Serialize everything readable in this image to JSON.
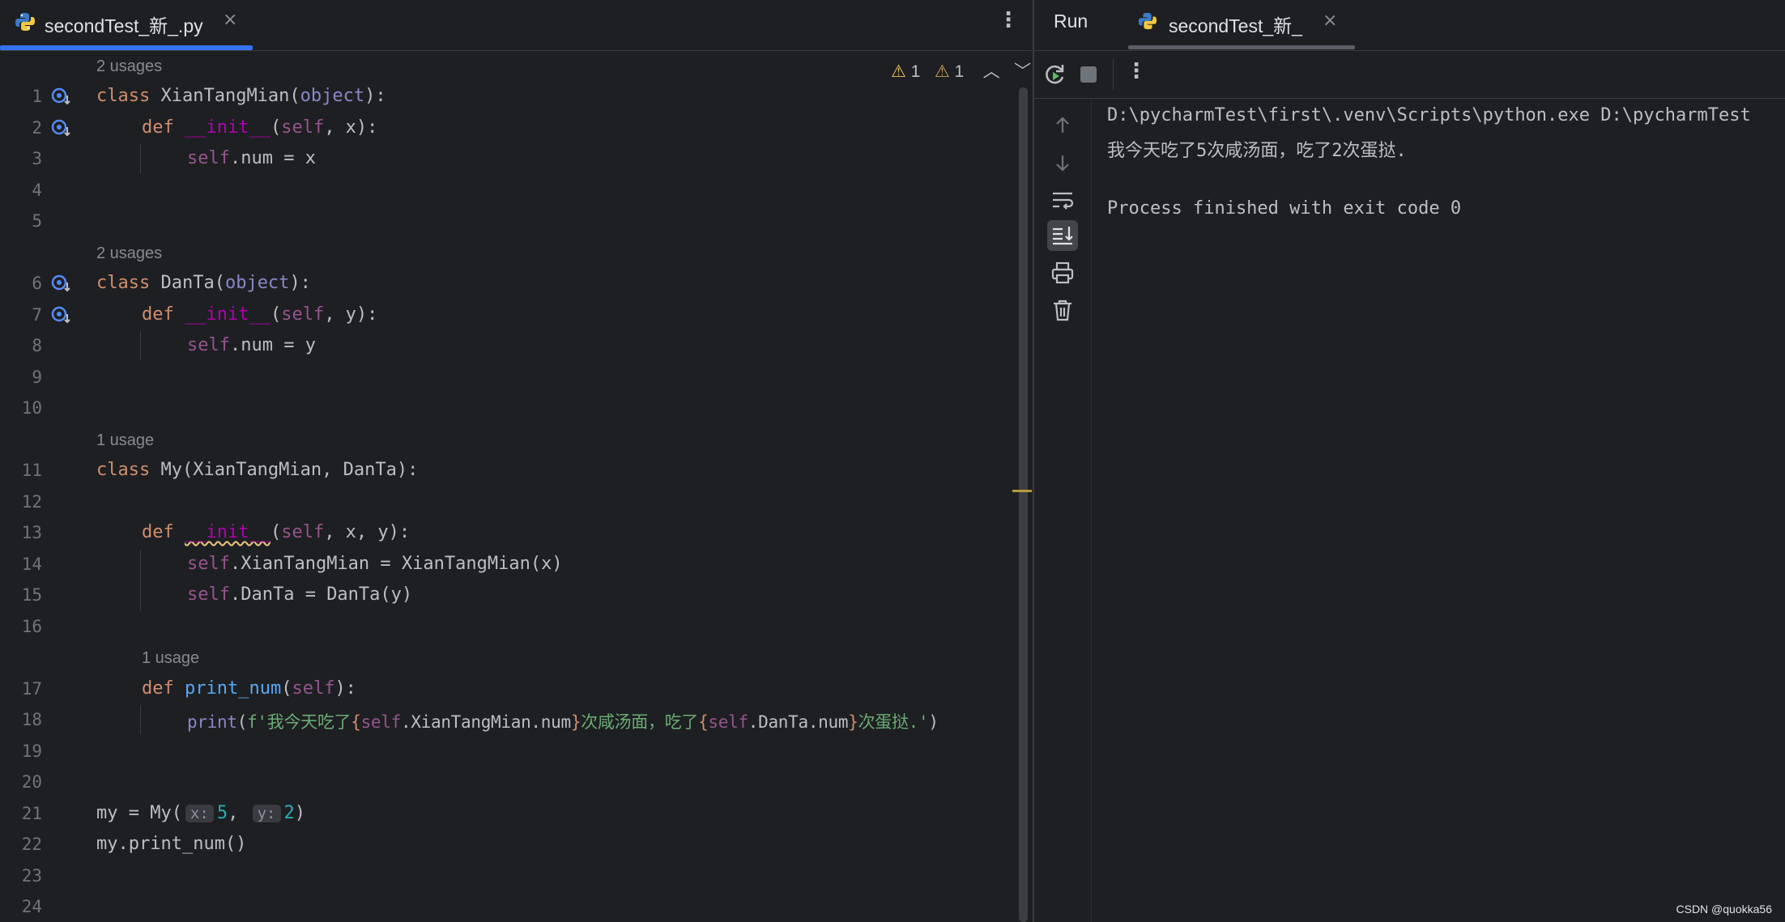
{
  "editor": {
    "tab_name": "secondTest_新_.py",
    "close_glyph": "×",
    "menu_glyph": "⋮",
    "inspections": {
      "warnings": "1",
      "weak_warnings": "1"
    },
    "usages": [
      "2 usages",
      "2 usages",
      "1 usage",
      "1 usage"
    ],
    "line_numbers": [
      "1",
      "2",
      "3",
      "4",
      "5",
      "6",
      "7",
      "8",
      "9",
      "10",
      "11",
      "12",
      "13",
      "14",
      "15",
      "16",
      "17",
      "18",
      "19",
      "20",
      "21",
      "22",
      "23",
      "24"
    ],
    "code": {
      "l1": {
        "kw": "class",
        "name": " XianTangMian(",
        "base": "object",
        "tail": "):"
      },
      "l2": {
        "kw": "def ",
        "dunder": "__init__",
        "p1": "(",
        "self": "self",
        "rest": ", x):"
      },
      "l3": {
        "self": "self",
        "rest": ".num = x"
      },
      "l6": {
        "kw": "class",
        "name": " DanTa(",
        "base": "object",
        "tail": "):"
      },
      "l7": {
        "kw": "def ",
        "dunder": "__init__",
        "p1": "(",
        "self": "self",
        "rest": ", y):"
      },
      "l8": {
        "self": "self",
        "rest": ".num = y"
      },
      "l11": {
        "kw": "class",
        "rest": " My(XianTangMian, DanTa):"
      },
      "l13": {
        "kw": "def ",
        "dunder": "__init__",
        "p1": "(",
        "self": "self",
        "rest": ", x, y):"
      },
      "l14": {
        "self": "self",
        "rest": ".XianTangMian = XianTangMian(x)"
      },
      "l15": {
        "self": "self",
        "rest": ".DanTa = DanTa(y)"
      },
      "l17": {
        "kw": "def ",
        "fn": "print_num",
        "p1": "(",
        "self": "self",
        "rest": "):"
      },
      "l18": {
        "builtin": "print",
        "p1": "(",
        "s1": "f'我今天吃了",
        "b1": "{",
        "self1": "self",
        "e1": ".XianTangMian.num",
        "b2": "}",
        "s2": "次咸汤面，吃了",
        "b3": "{",
        "self2": "self",
        "e2": ".DanTa.num",
        "b4": "}",
        "s3": "次蛋挞.'",
        "p2": ")"
      },
      "l21": {
        "pre": "my = My(",
        "hx": "x:",
        "n1": "5",
        "comma": ", ",
        "hy": "y:",
        "n2": "2",
        "post": ")"
      },
      "l22": {
        "text": "my.print_num()"
      }
    }
  },
  "run": {
    "title": "Run",
    "tab_name": "secondTest_新_",
    "close_glyph": "×",
    "menu_glyph": "⋮",
    "output": [
      "D:\\pycharmTest\\first\\.venv\\Scripts\\python.exe D:\\pycharmTest",
      "我今天吃了5次咸汤面，吃了2次蛋挞.",
      "",
      "Process finished with exit code 0"
    ]
  },
  "watermark": "CSDN @quokka56",
  "colors": {
    "accent": "#3574f0",
    "keyword": "#cf8e6d",
    "self": "#94558d",
    "dunder": "#b200b2",
    "string": "#6aab73",
    "number": "#2aacb8",
    "function": "#56a8f5",
    "warning": "#f2c55c"
  }
}
